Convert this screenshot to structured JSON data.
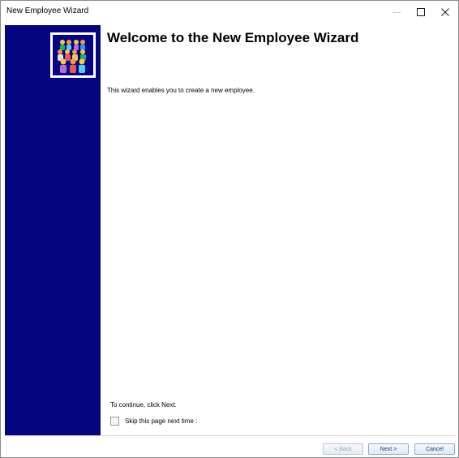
{
  "window": {
    "title": "New Employee Wizard",
    "controls": {
      "minimize": "—",
      "maximize": "☐",
      "close": "✕"
    }
  },
  "sidebar": {
    "background_color": "#050580",
    "logo_icon": "employees-group-icon"
  },
  "page": {
    "heading": "Welcome to the New Employee Wizard",
    "intro": "This wizard enables you to create a new employee.",
    "continue_text": "To continue, click Next.",
    "skip_label": "Skip this page next time :",
    "skip_checked": false
  },
  "buttons": {
    "back": "< Back",
    "next": "Next >",
    "cancel": "Cancel"
  }
}
